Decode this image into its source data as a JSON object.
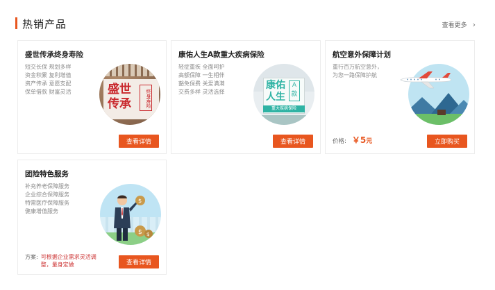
{
  "section": {
    "title": "热销产品",
    "more_label": "查看更多"
  },
  "cards": [
    {
      "title": "盛世传承终身寿险",
      "lines": [
        "短交长保 规划多样",
        "资金积累 复利增值",
        "资产传承 意愿支配",
        "保单借款 财富灵活"
      ],
      "image_big_text": "盛世传承",
      "image_tag_text": "终身寿险",
      "button": "查看详情"
    },
    {
      "title": "康佑人生A款重大疾病保险",
      "lines": [
        "轻症重疾 全面呵护",
        "高额保障 一生相伴",
        "豁免保费 关爱满满",
        "交费多样 灵活选择"
      ],
      "image_big_text": "康佑人生",
      "image_tag_text": "A款",
      "image_strip_text": "重大疾病保险",
      "button": "查看详情"
    },
    {
      "title": "航空意外保障计划",
      "lines": [
        "重行百万航空意外，",
        "为您一路保障护航"
      ],
      "price_label": "价格:",
      "price_symbol": "￥",
      "price_amount": "5",
      "price_unit": "元",
      "button": "立即购买"
    },
    {
      "title": "团险特色服务",
      "lines": [
        "补充养老保障服务",
        "企业综合保障服务",
        "特需医疗保障服务",
        "健康增值服务"
      ],
      "plan_label": "方案:",
      "plan_text": "可根据企业需求灵活调整，量身定做",
      "button": "查看详情"
    }
  ],
  "colors": {
    "accent": "#e8561f",
    "teal": "#2fb3a4",
    "red": "#c9282d"
  }
}
